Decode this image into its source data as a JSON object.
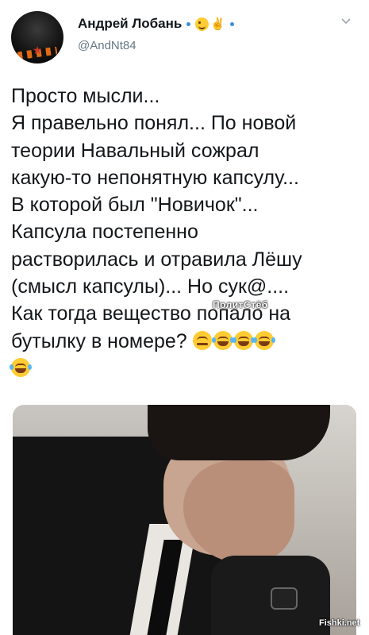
{
  "tweet": {
    "author": {
      "display_name": "Андрей Лобань",
      "handle": "@AndNt84",
      "name_emojis": [
        "wink-face-emoji",
        "victory-hand-emoji"
      ]
    },
    "lines": [
      "Просто мысли...",
      "Я правельно понял... По новой",
      "теории Навальный сожрал",
      "какую-то непонятную капсулу...",
      "В которой был \"Новичок\"...",
      "Капсула постепенно",
      "растворилась и отравила Лёшу",
      "(смысл капсулы)... Но сук@....",
      "Как тогда вещество попало на",
      "бутылку в номере?"
    ],
    "trailing_emojis": [
      "persevering-face-emoji",
      "joy-emoji",
      "joy-emoji",
      "joy-emoji",
      "joy-emoji"
    ],
    "image_alt": "facepalm-photo"
  },
  "watermarks": {
    "inline": "ПолитСтёб",
    "corner": "Fishki.net"
  },
  "colors": {
    "text": "#14171a",
    "secondary": "#657786",
    "verified_dot": "#3a8fd8"
  }
}
